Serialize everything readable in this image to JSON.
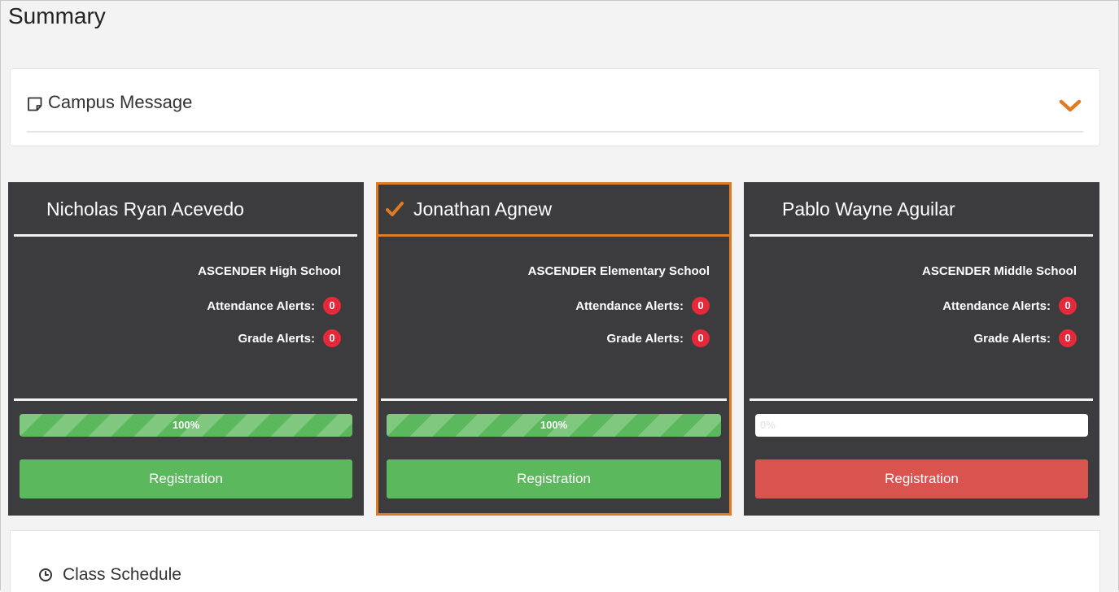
{
  "page": {
    "title": "Summary"
  },
  "campus_message": {
    "title": "Campus Message",
    "icon": "message-icon",
    "toggle_icon": "chevron-down-icon",
    "accent": "#e07b24"
  },
  "students": [
    {
      "name": "Nicholas Ryan Acevedo",
      "selected": false,
      "school": "ASCENDER High School",
      "attendance_label": "Attendance Alerts:",
      "attendance_count": "0",
      "grade_label": "Grade Alerts:",
      "grade_count": "0",
      "progress_percent": 100,
      "progress_label": "100%",
      "registration_label": "Registration",
      "registration_status_color": "#5cb85c"
    },
    {
      "name": "Jonathan Agnew",
      "selected": true,
      "school": "ASCENDER Elementary School",
      "attendance_label": "Attendance Alerts:",
      "attendance_count": "0",
      "grade_label": "Grade Alerts:",
      "grade_count": "0",
      "progress_percent": 100,
      "progress_label": "100%",
      "registration_label": "Registration",
      "registration_status_color": "#5cb85c"
    },
    {
      "name": "Pablo Wayne Aguilar",
      "selected": false,
      "school": "ASCENDER Middle School",
      "attendance_label": "Attendance Alerts:",
      "attendance_count": "0",
      "grade_label": "Grade Alerts:",
      "grade_count": "0",
      "progress_percent": 0,
      "progress_label": "0%",
      "registration_label": "Registration",
      "registration_status_color": "#d9534f"
    }
  ],
  "class_schedule": {
    "title": "Class Schedule",
    "icon": "clock-icon"
  },
  "colors": {
    "card_bg": "#3c3c3e",
    "selected_border": "#e07b24",
    "alert_badge": "#e5283a"
  }
}
